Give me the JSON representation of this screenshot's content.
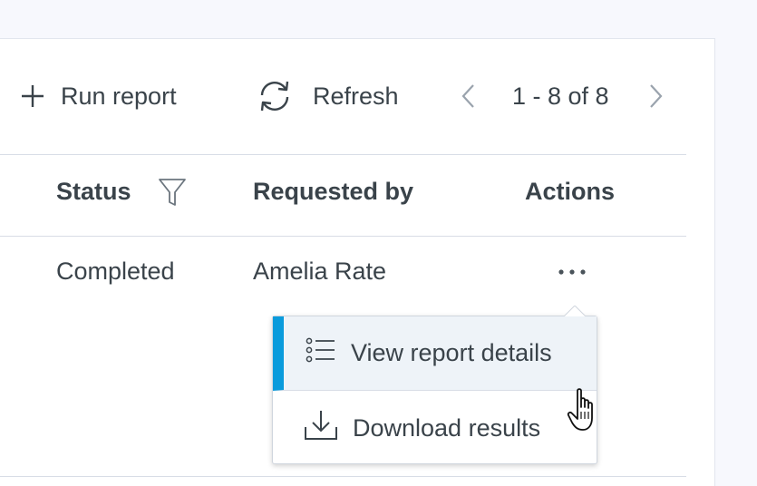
{
  "toolbar": {
    "run_report_label": "Run report",
    "refresh_label": "Refresh",
    "pagination_text": "1 - 8 of 8"
  },
  "table": {
    "columns": [
      "Status",
      "Requested by",
      "Actions"
    ],
    "rows": [
      {
        "status": "Completed",
        "requested_by": "Amelia Rate",
        "actions": "…"
      }
    ]
  },
  "row_menu": {
    "items": [
      {
        "label": "View report details",
        "icon": "list-icon",
        "active": true
      },
      {
        "label": "Download results",
        "icon": "download-icon",
        "active": false
      }
    ]
  },
  "colors": {
    "accent": "#0a9bdc",
    "text": "#3a434a",
    "border": "#d8dde6",
    "hover_bg": "#eef3f8",
    "page_bg": "#f7f8fd"
  }
}
